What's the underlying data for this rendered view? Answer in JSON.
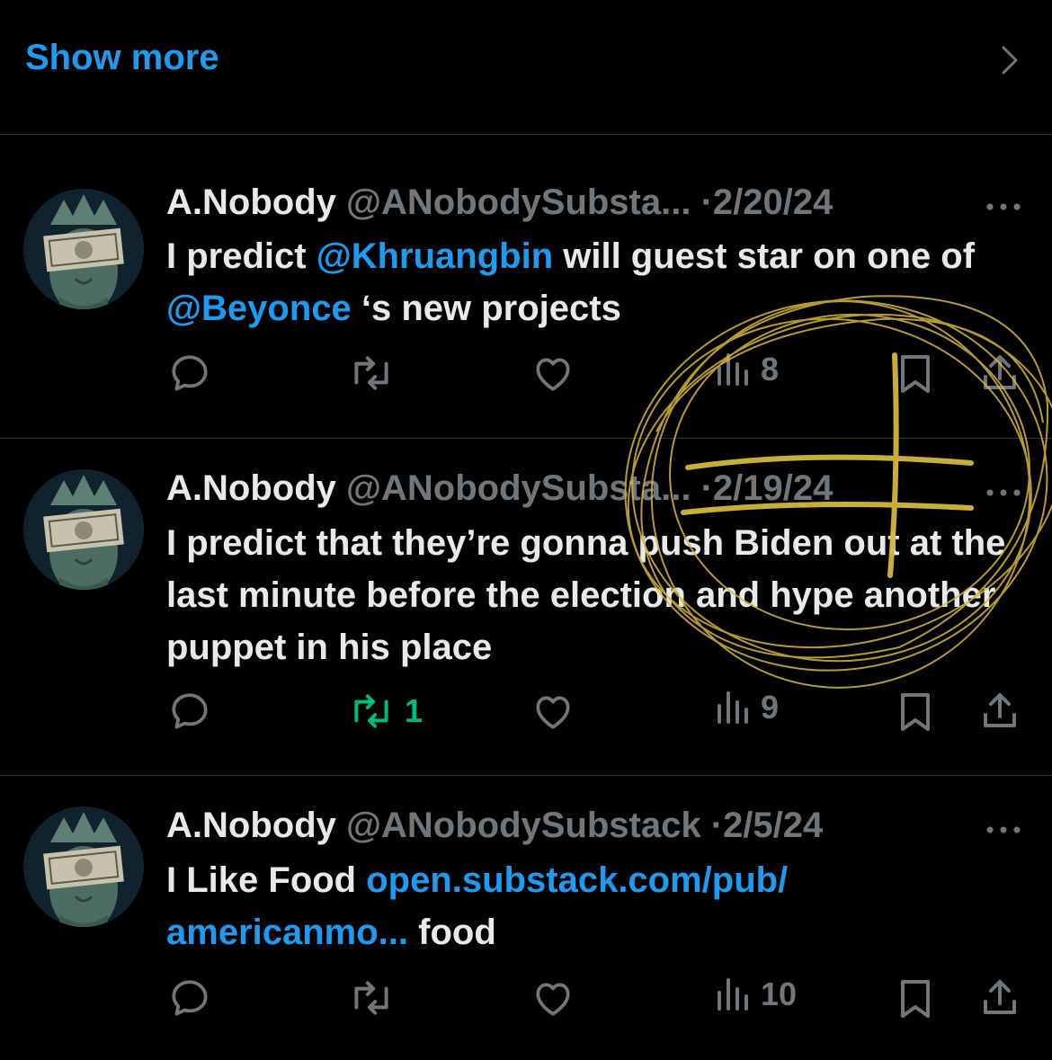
{
  "show_more": {
    "label": "Show more"
  },
  "tweets": [
    {
      "name": "A.Nobody",
      "handle": "@ANobodySubsta...",
      "date": "2/20/24",
      "segments": [
        {
          "t": "I predict ",
          "link": false
        },
        {
          "t": "@Khruangbin",
          "link": true
        },
        {
          "t": " will guest star on one of ",
          "link": false
        },
        {
          "t": "@Beyonce",
          "link": true
        },
        {
          "t": " ‘s new projects",
          "link": false
        }
      ],
      "retweets": "",
      "views": "8"
    },
    {
      "name": "A.Nobody",
      "handle": "@ANobodySubsta...",
      "date": "2/19/24",
      "segments": [
        {
          "t": "I predict that they’re gonna push Biden out at the last minute before the election and hype another puppet in his place",
          "link": false
        }
      ],
      "retweets": "1",
      "views": "9"
    },
    {
      "name": "A.Nobody",
      "handle": "@ANobodySubstack",
      "date": "2/5/24",
      "segments": [
        {
          "t": "I Like Food ",
          "link": false
        },
        {
          "t": "open.substack.com/pub/ americanmo...",
          "link": true
        },
        {
          "t": " food",
          "link": false
        }
      ],
      "retweets": "",
      "views": "10"
    }
  ],
  "separator": "·",
  "colors": {
    "background": "#000000",
    "text": "#e7e9ea",
    "muted": "#71767b",
    "link": "#1d9bf0",
    "retweet_active": "#00ba7c",
    "scribble": "#d4b83a"
  },
  "icons": [
    "chevron-right-icon",
    "more-icon",
    "reply-icon",
    "retweet-icon",
    "like-icon",
    "views-icon",
    "bookmark-icon",
    "share-icon"
  ]
}
